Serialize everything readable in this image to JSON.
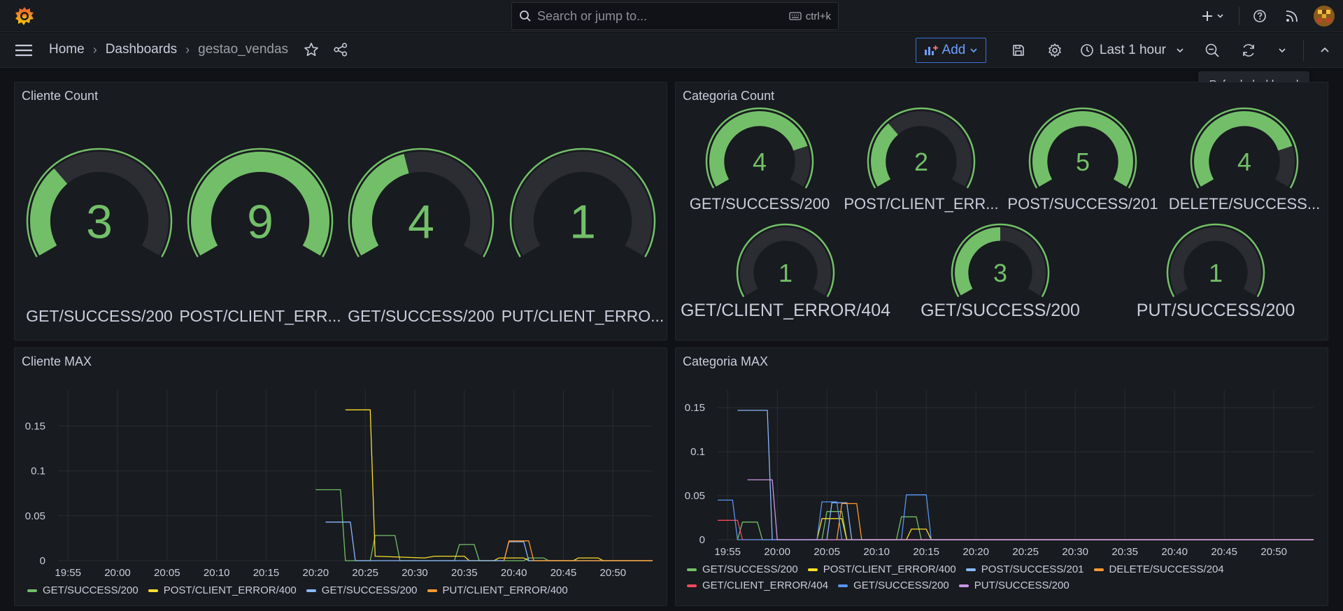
{
  "search": {
    "placeholder": "Search or jump to...",
    "shortcut": "ctrl+k"
  },
  "breadcrumb": {
    "home": "Home",
    "dashboards": "Dashboards",
    "current": "gestao_vendas"
  },
  "toolbar": {
    "add_label": "Add",
    "time_range": "Last 1 hour",
    "tooltip": "Refresh dashboard"
  },
  "colors": {
    "green": "#73bf69",
    "yellow": "#fade2a",
    "blue": "#8ab8ff",
    "orange": "#ff9830",
    "red": "#f2495c",
    "blue2": "#5794f2",
    "purple": "#ca95e5",
    "gauge_bg": "#2b2d33"
  },
  "panels": {
    "cliente_count": {
      "title": "Cliente Count",
      "gauges": [
        {
          "value": "3",
          "label": "GET/SUCCESS/200",
          "fraction": 0.33
        },
        {
          "value": "9",
          "label": "POST/CLIENT_ERR...",
          "fraction": 1.0
        },
        {
          "value": "4",
          "label": "GET/SUCCESS/200",
          "fraction": 0.44
        },
        {
          "value": "1",
          "label": "PUT/CLIENT_ERRO...",
          "fraction": 0.0
        }
      ]
    },
    "categoria_count": {
      "title": "Categoria Count",
      "gauges": [
        {
          "value": "4",
          "label": "GET/SUCCESS/200",
          "fraction": 0.8
        },
        {
          "value": "2",
          "label": "POST/CLIENT_ERR...",
          "fraction": 0.33
        },
        {
          "value": "5",
          "label": "POST/SUCCESS/201",
          "fraction": 1.0
        },
        {
          "value": "4",
          "label": "DELETE/SUCCESS...",
          "fraction": 0.8
        },
        {
          "value": "1",
          "label": "GET/CLIENT_ERROR/404",
          "fraction": 0.0
        },
        {
          "value": "3",
          "label": "GET/SUCCESS/200",
          "fraction": 0.5
        },
        {
          "value": "1",
          "label": "PUT/SUCCESS/200",
          "fraction": 0.0
        }
      ]
    },
    "cliente_max": {
      "title": "Cliente MAX",
      "legend": [
        "GET/SUCCESS/200",
        "POST/CLIENT_ERROR/400",
        "GET/SUCCESS/200",
        "PUT/CLIENT_ERROR/400"
      ]
    },
    "categoria_max": {
      "title": "Categoria MAX",
      "legend": [
        "GET/SUCCESS/200",
        "POST/CLIENT_ERROR/400",
        "POST/SUCCESS/201",
        "DELETE/SUCCESS/204",
        "GET/CLIENT_ERROR/404",
        "GET/SUCCESS/200",
        "PUT/SUCCESS/200"
      ]
    }
  },
  "chart_data": [
    {
      "type": "line",
      "title": "Cliente MAX",
      "x_ticks": [
        "19:55",
        "20:00",
        "20:05",
        "20:10",
        "20:15",
        "20:20",
        "20:25",
        "20:30",
        "20:35",
        "20:40",
        "20:45",
        "20:50"
      ],
      "y_ticks": [
        "0",
        "0.05",
        "0.1",
        "0.15"
      ],
      "xlim": [
        "19:54",
        "20:54"
      ],
      "ylim": [
        0,
        0.19
      ],
      "series": [
        {
          "name": "GET/SUCCESS/200",
          "color": "#73bf69",
          "points": [
            [
              "20:20",
              0.079
            ],
            [
              "20:22.5",
              0.079
            ],
            [
              "20:23",
              0
            ],
            [
              "20:25.5",
              0
            ],
            [
              "20:26",
              0.028
            ],
            [
              "20:28",
              0.028
            ],
            [
              "20:28.5",
              0
            ],
            [
              "20:34",
              0
            ],
            [
              "20:34.5",
              0.018
            ],
            [
              "20:36",
              0.018
            ],
            [
              "20:36.5",
              0
            ],
            [
              "20:41",
              0
            ],
            [
              "20:41.5",
              0.003
            ],
            [
              "20:43",
              0.003
            ],
            [
              "20:43.5",
              0
            ],
            [
              "20:54",
              0
            ]
          ]
        },
        {
          "name": "POST/CLIENT_ERROR/400",
          "color": "#fade2a",
          "points": [
            [
              "20:23",
              0.168
            ],
            [
              "20:25.5",
              0.168
            ],
            [
              "20:26",
              0.005
            ],
            [
              "20:31",
              0.003
            ],
            [
              "20:32",
              0.005
            ],
            [
              "20:35",
              0.005
            ],
            [
              "20:35.5",
              0
            ],
            [
              "20:38",
              0
            ],
            [
              "20:38.5",
              0.003
            ],
            [
              "20:41",
              0.003
            ],
            [
              "20:41.5",
              0
            ],
            [
              "20:46",
              0
            ],
            [
              "20:46.5",
              0.003
            ],
            [
              "20:48.5",
              0.003
            ],
            [
              "20:49",
              0
            ],
            [
              "20:54",
              0
            ]
          ]
        },
        {
          "name": "GET/SUCCESS/200",
          "color": "#8ab8ff",
          "points": [
            [
              "20:21",
              0.043
            ],
            [
              "20:23.5",
              0.043
            ],
            [
              "20:24",
              0
            ],
            [
              "20:39",
              0
            ],
            [
              "20:39.5",
              0.021
            ],
            [
              "20:41",
              0.021
            ],
            [
              "20:41.5",
              0
            ],
            [
              "20:54",
              0
            ]
          ]
        },
        {
          "name": "PUT/CLIENT_ERROR/400",
          "color": "#ff9830",
          "points": [
            [
              "20:39",
              0
            ],
            [
              "20:39.5",
              0.022
            ],
            [
              "20:41.5",
              0.022
            ],
            [
              "20:42",
              0
            ],
            [
              "20:54",
              0
            ]
          ]
        }
      ]
    },
    {
      "type": "line",
      "title": "Categoria MAX",
      "x_ticks": [
        "19:55",
        "20:00",
        "20:05",
        "20:10",
        "20:15",
        "20:20",
        "20:25",
        "20:30",
        "20:35",
        "20:40",
        "20:45",
        "20:50"
      ],
      "y_ticks": [
        "0",
        "0.05",
        "0.1",
        "0.15"
      ],
      "xlim": [
        "19:54",
        "20:54"
      ],
      "ylim": [
        0,
        0.17
      ],
      "series": [
        {
          "name": "GET/SUCCESS/200",
          "color": "#73bf69",
          "points": [
            [
              "19:56",
              0
            ],
            [
              "19:56.5",
              0.02
            ],
            [
              "19:58",
              0.02
            ],
            [
              "19:58.5",
              0
            ],
            [
              "20:04.5",
              0
            ],
            [
              "20:05",
              0.032
            ],
            [
              "20:06.5",
              0.032
            ],
            [
              "20:07",
              0
            ],
            [
              "20:12",
              0
            ],
            [
              "20:12.5",
              0.026
            ],
            [
              "20:14",
              0.026
            ],
            [
              "20:14.5",
              0
            ],
            [
              "20:54",
              0
            ]
          ]
        },
        {
          "name": "POST/CLIENT_ERROR/400",
          "color": "#fade2a",
          "points": [
            [
              "20:04",
              0
            ],
            [
              "20:04.5",
              0.024
            ],
            [
              "20:06.5",
              0.024
            ],
            [
              "20:07",
              0
            ],
            [
              "20:13",
              0
            ],
            [
              "20:13.5",
              0.012
            ],
            [
              "20:15",
              0.012
            ],
            [
              "20:15.5",
              0
            ],
            [
              "20:54",
              0
            ]
          ]
        },
        {
          "name": "POST/SUCCESS/201",
          "color": "#8ab8ff",
          "points": [
            [
              "19:56",
              0.147
            ],
            [
              "19:59",
              0.147
            ],
            [
              "19:59.5",
              0
            ],
            [
              "20:05",
              0
            ],
            [
              "20:05.5",
              0.042
            ],
            [
              "20:07",
              0.042
            ],
            [
              "20:07.5",
              0
            ],
            [
              "20:54",
              0
            ]
          ]
        },
        {
          "name": "DELETE/SUCCESS/204",
          "color": "#ff9830",
          "points": [
            [
              "20:06",
              0
            ],
            [
              "20:06.5",
              0.041
            ],
            [
              "20:08",
              0.041
            ],
            [
              "20:08.5",
              0
            ],
            [
              "20:54",
              0
            ]
          ]
        },
        {
          "name": "GET/CLIENT_ERROR/404",
          "color": "#f2495c",
          "points": [
            [
              "19:54",
              0.022
            ],
            [
              "19:56",
              0.022
            ],
            [
              "19:56.5",
              0
            ],
            [
              "20:54",
              0
            ]
          ]
        },
        {
          "name": "GET/SUCCESS/200",
          "color": "#5794f2",
          "points": [
            [
              "19:54",
              0.045
            ],
            [
              "19:55.5",
              0.045
            ],
            [
              "19:56",
              0
            ],
            [
              "20:04",
              0
            ],
            [
              "20:04.5",
              0.043
            ],
            [
              "20:06",
              0.043
            ],
            [
              "20:06.5",
              0
            ],
            [
              "20:12.5",
              0
            ],
            [
              "20:13",
              0.051
            ],
            [
              "20:15",
              0.051
            ],
            [
              "20:15.5",
              0
            ],
            [
              "20:54",
              0
            ]
          ]
        },
        {
          "name": "PUT/SUCCESS/200",
          "color": "#ca95e5",
          "points": [
            [
              "19:57",
              0.068
            ],
            [
              "19:59.5",
              0.068
            ],
            [
              "20:00",
              0
            ],
            [
              "20:54",
              0
            ]
          ]
        }
      ]
    }
  ]
}
